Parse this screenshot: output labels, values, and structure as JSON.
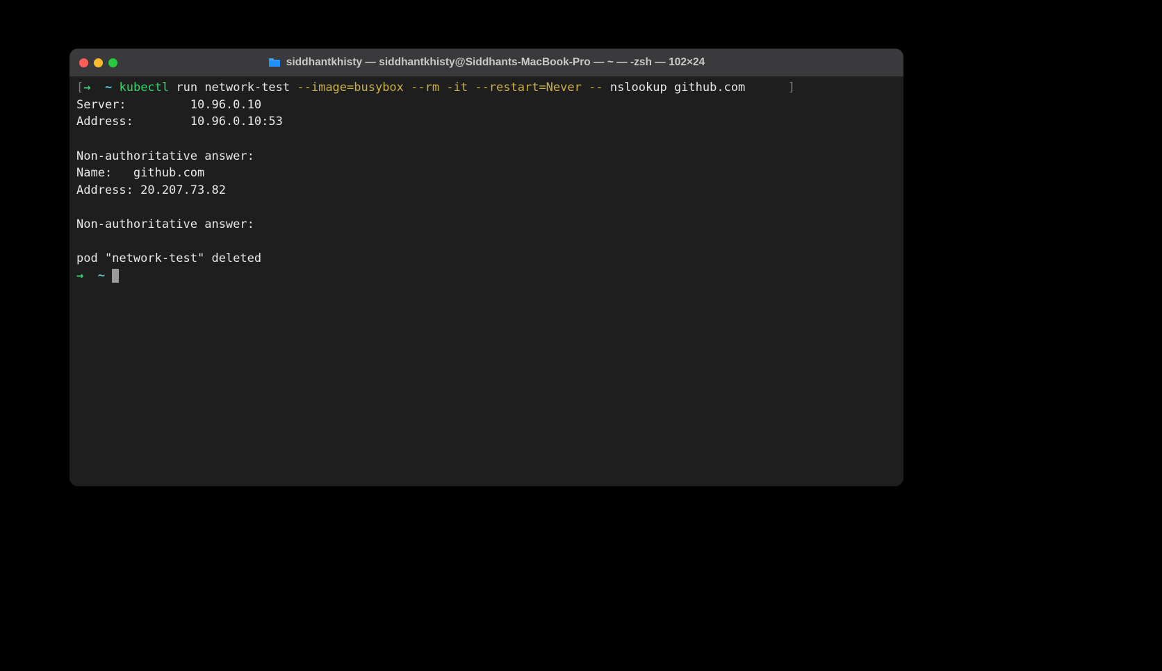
{
  "window": {
    "title": "siddhantkhisty — siddhantkhisty@Siddhants-MacBook-Pro — ~ — -zsh — 102×24"
  },
  "prompt": {
    "bracket_open": "[",
    "bracket_close": "]",
    "arrow": "→",
    "tilde": "~",
    "command_keyword": "kubectl",
    "command_rest": " run network-test ",
    "flag_image": "--image=busybox",
    "flag_rm": "--rm",
    "flag_it": "-it",
    "flag_restart": "--restart=Never",
    "dashdash": "--",
    "post_dash": " nslookup github.com"
  },
  "output": {
    "line_server": "Server:         10.96.0.10",
    "line_address1": "Address:        10.96.0.10:53",
    "blank1": "",
    "line_nonauth1": "Non-authoritative answer:",
    "line_name": "Name:   github.com",
    "line_address2": "Address: 20.207.73.82",
    "blank2": "",
    "line_nonauth2": "Non-authoritative answer:",
    "blank3": "",
    "line_deleted": "pod \"network-test\" deleted"
  },
  "prompt2": {
    "arrow": "→",
    "tilde": "~"
  }
}
